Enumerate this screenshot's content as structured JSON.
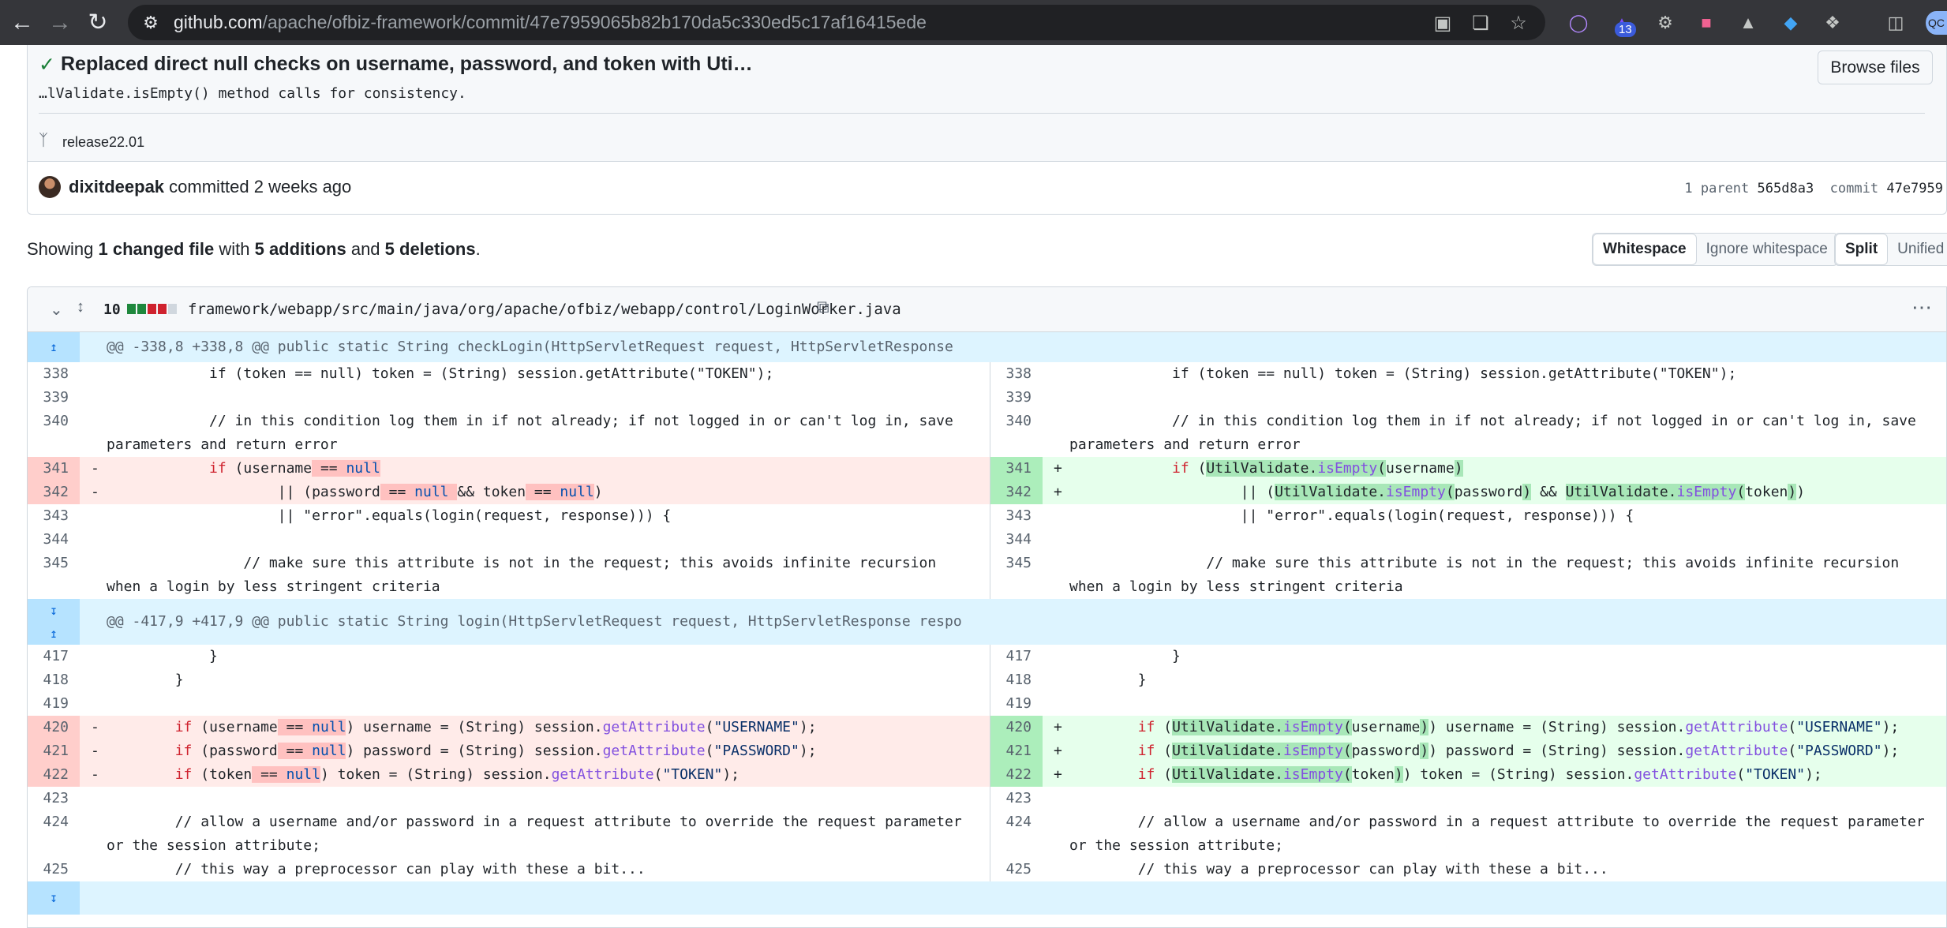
{
  "browser": {
    "url_host": "github.com",
    "url_path": "/apache/ofbiz-framework/commit/47e7959065b82b170da5c330ed5c17af16415ede",
    "ext_badge": "13",
    "profile": "QC"
  },
  "commit": {
    "title": "Replaced direct null checks on username, password, and token with Uti…",
    "description": "…lValidate.isEmpty() method calls for consistency.",
    "browse_label": "Browse files",
    "branch": "release22.01",
    "author": "dixitdeepak",
    "committed_text": "committed 2 weeks ago",
    "parent_label": "1 parent",
    "parent_sha": "565d8a3",
    "commit_label": "commit",
    "commit_sha": "47e7959"
  },
  "summary": {
    "showing": "Showing ",
    "changed": "1 changed file",
    "with": " with ",
    "additions": "5 additions",
    "and": " and ",
    "deletions": "5 deletions",
    "end": "."
  },
  "toolbar": {
    "whitespace": "Whitespace",
    "ignore_whitespace": "Ignore whitespace",
    "split": "Split",
    "unified": "Unified"
  },
  "file": {
    "change_count": "10",
    "path": "framework/webapp/src/main/java/org/apache/ofbiz/webapp/control/LoginWorker.java"
  },
  "hunks": [
    "@@ -338,8 +338,8 @@ public static String checkLogin(HttpServletRequest request, HttpServletResponse",
    "@@ -417,9 +417,9 @@ public static String login(HttpServletRequest request, HttpServletResponse respo"
  ],
  "line_numbers": {
    "l338": "338",
    "l339": "339",
    "l340": "340",
    "l341": "341",
    "l342": "342",
    "l343": "343",
    "l344": "344",
    "l345": "345",
    "l417": "417",
    "l418": "418",
    "l419": "419",
    "l420": "420",
    "l421": "421",
    "l422": "422",
    "l423": "423",
    "l424": "424",
    "l425": "425"
  },
  "code": {
    "c338": "            if (token == null) token = (String) session.getAttribute(\"TOKEN\");",
    "c340": "            // in this condition log them in if not already; if not logged in or can't log in, save parameters and return error",
    "c343": "                    || \"error\".equals(login(request, response))) {",
    "c345": "                // make sure this attribute is not in the request; this avoids infinite recursion when a login by less stringent criteria",
    "c417": "            }",
    "c418": "        }",
    "c424": "        // allow a username and/or password in a request attribute to override the request parameter or the session attribute;",
    "c425": "        // this way a preprocessor can play with these a bit..."
  },
  "markers": {
    "minus": "-",
    "plus": "+"
  }
}
